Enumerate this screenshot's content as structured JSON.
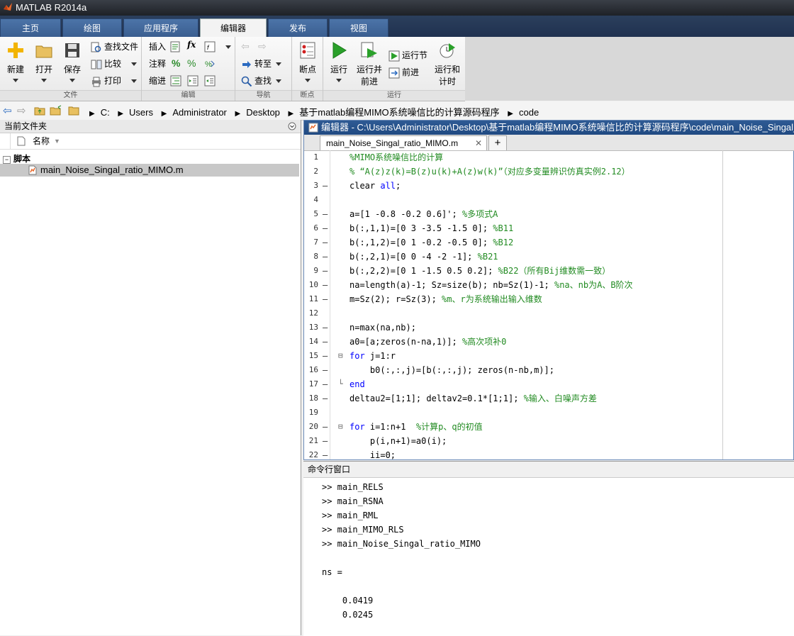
{
  "window": {
    "title": "MATLAB R2014a"
  },
  "tabs": [
    {
      "label": "主页"
    },
    {
      "label": "绘图"
    },
    {
      "label": "应用程序"
    },
    {
      "label": "编辑器"
    },
    {
      "label": "发布"
    },
    {
      "label": "视图"
    }
  ],
  "ribbon": {
    "file_section": {
      "title": "文件",
      "new": "新建",
      "open": "打开",
      "save": "保存",
      "find_files": "查找文件",
      "compare": "比较",
      "print": "打印"
    },
    "edit_section": {
      "title": "编辑",
      "insert": "插入",
      "comment": "注释",
      "indent": "缩进",
      "fx": "fx"
    },
    "navigate_section": {
      "title": "导航",
      "goto": "转至",
      "find": "查找"
    },
    "breakpoints_section": {
      "title": "断点",
      "breakpoints": "断点"
    },
    "run_section": {
      "title": "运行",
      "run": "运行",
      "run_advance_1": "运行并",
      "run_advance_2": "前进",
      "run_section": "运行节",
      "advance": "前进",
      "run_time_1": "运行和",
      "run_time_2": "计时"
    }
  },
  "address": {
    "crumbs": [
      "C:",
      "Users",
      "Administrator",
      "Desktop",
      "基于matlab编程MIMO系统噪信比的计算源码程序",
      "code"
    ]
  },
  "file_panel": {
    "title": "当前文件夹",
    "column_name": "名称",
    "group": "脚本",
    "files": [
      "main_Noise_Singal_ratio_MIMO.m"
    ]
  },
  "editor": {
    "title": "编辑器 - C:\\Users\\Administrator\\Desktop\\基于matlab编程MIMO系统噪信比的计算源码程序\\code\\main_Noise_Singal_ratio_MIMO.m",
    "tab_label": "main_Noise_Singal_ratio_MIMO.m",
    "add_tab": "+",
    "lines": [
      {
        "n": "1",
        "dash": "",
        "fold": "",
        "code": "",
        "comment": "%MIMO系统噪信比的计算"
      },
      {
        "n": "2",
        "dash": "",
        "fold": "",
        "code": "",
        "comment": "% “A(z)z(k)=B(z)u(k)+A(z)w(k)”（对应多变量辨识仿真实例2.12）"
      },
      {
        "n": "3",
        "dash": "–",
        "fold": "",
        "code": "clear ",
        "kwcode": "all",
        "code2": ";",
        "comment": ""
      },
      {
        "n": "4",
        "dash": "",
        "fold": "",
        "code": "",
        "comment": ""
      },
      {
        "n": "5",
        "dash": "–",
        "fold": "",
        "code": "a=[1 -0.8 -0.2 0.6]'; ",
        "comment": "%多项式A"
      },
      {
        "n": "6",
        "dash": "–",
        "fold": "",
        "code": "b(:,1,1)=[0 3 -3.5 -1.5 0]; ",
        "comment": "%B11"
      },
      {
        "n": "7",
        "dash": "–",
        "fold": "",
        "code": "b(:,1,2)=[0 1 -0.2 -0.5 0]; ",
        "comment": "%B12"
      },
      {
        "n": "8",
        "dash": "–",
        "fold": "",
        "code": "b(:,2,1)=[0 0 -4 -2 -1]; ",
        "comment": "%B21"
      },
      {
        "n": "9",
        "dash": "–",
        "fold": "",
        "code": "b(:,2,2)=[0 1 -1.5 0.5 0.2]; ",
        "comment": "%B22（所有Bij维数需一致）"
      },
      {
        "n": "10",
        "dash": "–",
        "fold": "",
        "code": "na=length(a)-1; Sz=size(b); nb=Sz(1)-1; ",
        "comment": "%na、nb为A、B阶次"
      },
      {
        "n": "11",
        "dash": "–",
        "fold": "",
        "code": "m=Sz(2); r=Sz(3); ",
        "comment": "%m、r为系统输出输入维数"
      },
      {
        "n": "12",
        "dash": "",
        "fold": "",
        "code": "",
        "comment": ""
      },
      {
        "n": "13",
        "dash": "–",
        "fold": "",
        "code": "n=max(na,nb);",
        "comment": ""
      },
      {
        "n": "14",
        "dash": "–",
        "fold": "",
        "code": "a0=[a;zeros(n-na,1)]; ",
        "comment": "%高次项补0"
      },
      {
        "n": "15",
        "dash": "–",
        "fold": "⊟",
        "kwfirst": "for",
        "code": " j=1:r",
        "comment": ""
      },
      {
        "n": "16",
        "dash": "–",
        "fold": "",
        "code": "    b0(:,:,j)=[b(:,:,j); zeros(n-nb,m)];",
        "comment": ""
      },
      {
        "n": "17",
        "dash": "–",
        "fold": "└",
        "kwfirst": "end",
        "code": "",
        "comment": ""
      },
      {
        "n": "18",
        "dash": "–",
        "fold": "",
        "code": "deltau2=[1;1]; deltav2=0.1*[1;1]; ",
        "comment": "%输入、白噪声方差"
      },
      {
        "n": "19",
        "dash": "",
        "fold": "",
        "code": "",
        "comment": ""
      },
      {
        "n": "20",
        "dash": "–",
        "fold": "⊟",
        "kwfirst": "for",
        "code": " i=1:n+1  ",
        "comment": "%计算p、q的初值"
      },
      {
        "n": "21",
        "dash": "–",
        "fold": "",
        "code": "    p(i,n+1)=a0(i);",
        "comment": ""
      },
      {
        "n": "22",
        "dash": "–",
        "fold": "",
        "code": "    ii=0;",
        "comment": ""
      }
    ]
  },
  "command_window": {
    "title": "命令行窗口",
    "lines": [
      ">> main_RELS",
      ">> main_RSNA",
      ">> main_RML",
      ">> main_MIMO_RLS",
      ">> main_Noise_Singal_ratio_MIMO",
      "",
      "ns =",
      "",
      "    0.0419",
      "    0.0245"
    ]
  }
}
